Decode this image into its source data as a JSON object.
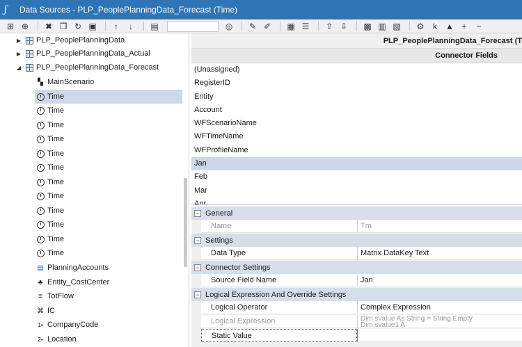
{
  "window": {
    "title": "Data Sources - PLP_PeoplePlanningData_Forecast  (Time)"
  },
  "toolbar": {
    "search_placeholder": ""
  },
  "tree": {
    "items": [
      {
        "label": "PLP_PeoplePlanningData",
        "indent": 0,
        "caret": "▶",
        "icon": "table-grid-icon"
      },
      {
        "label": "PLP_PeoplePlanningData_Actual",
        "indent": 0,
        "caret": "▶",
        "icon": "table-grid-icon"
      },
      {
        "label": "PLP_PeoplePlanningData_Forecast",
        "indent": 0,
        "caret": "◢",
        "icon": "table-grid-icon"
      },
      {
        "label": "MainScenario",
        "indent": 1,
        "caret": "",
        "icon": "scenario-icon"
      },
      {
        "label": "Time",
        "indent": 1,
        "caret": "",
        "icon": "clock-icon",
        "selected": true
      },
      {
        "label": "Time",
        "indent": 1,
        "caret": "",
        "icon": "clock-icon"
      },
      {
        "label": "Time",
        "indent": 1,
        "caret": "",
        "icon": "clock-icon"
      },
      {
        "label": "Time",
        "indent": 1,
        "caret": "",
        "icon": "clock-icon"
      },
      {
        "label": "Time",
        "indent": 1,
        "caret": "",
        "icon": "clock-icon"
      },
      {
        "label": "Time",
        "indent": 1,
        "caret": "",
        "icon": "clock-icon"
      },
      {
        "label": "Time",
        "indent": 1,
        "caret": "",
        "icon": "clock-icon"
      },
      {
        "label": "Time",
        "indent": 1,
        "caret": "",
        "icon": "clock-icon"
      },
      {
        "label": "Time",
        "indent": 1,
        "caret": "",
        "icon": "clock-icon"
      },
      {
        "label": "Time",
        "indent": 1,
        "caret": "",
        "icon": "clock-icon"
      },
      {
        "label": "Time",
        "indent": 1,
        "caret": "",
        "icon": "clock-icon"
      },
      {
        "label": "Time",
        "indent": 1,
        "caret": "",
        "icon": "clock-icon"
      },
      {
        "label": "PlanningAccounts",
        "indent": 1,
        "caret": "",
        "icon": "account-icon"
      },
      {
        "label": "Entity_CostCenter",
        "indent": 1,
        "caret": "",
        "icon": "hierarchy-icon"
      },
      {
        "label": "TotFlow",
        "indent": 1,
        "caret": "",
        "icon": "flow-icon"
      },
      {
        "label": "IC",
        "indent": 1,
        "caret": "",
        "icon": "ic-icon"
      },
      {
        "label": "CompanyCode",
        "indent": 1,
        "caret": "",
        "icon": "ud-icon",
        "badge": "1"
      },
      {
        "label": "Location",
        "indent": 1,
        "caret": "",
        "icon": "ud-icon",
        "badge": "2"
      }
    ]
  },
  "table": {
    "header": "PLP_PeoplePlanningData_Forecast  (T",
    "column": "Connector Fields",
    "fields": [
      "(Unassigned)",
      "RegisterID",
      "Entity",
      "Account",
      "WFScenarioName",
      "WFTimeName",
      "WFProfileName",
      "Jan",
      "Feb",
      "Mar",
      "Apr"
    ],
    "selected_field": "Jan"
  },
  "properties": {
    "sections": [
      {
        "type": "cat",
        "label": "General"
      },
      {
        "type": "prop",
        "name": "Name",
        "value": "Tm",
        "muted": true
      },
      {
        "type": "cat",
        "label": "Settings"
      },
      {
        "type": "prop",
        "name": "Data Type",
        "value": "Matrix DataKey Text"
      },
      {
        "type": "cat",
        "label": "Connector Settings"
      },
      {
        "type": "prop",
        "name": "Source Field Name",
        "value": "Jan"
      },
      {
        "type": "cat",
        "label": "Logical Expression And Override Settings"
      },
      {
        "type": "prop",
        "name": "Logical Operator",
        "value": "Complex Expression"
      },
      {
        "type": "prop",
        "name": "Logical Expression",
        "value": "Dim svalue As String = String.Empty",
        "value2": "Dim svalue1 A",
        "muted": true
      },
      {
        "type": "prop",
        "name": "Static Value",
        "value": ""
      }
    ]
  },
  "colors": {
    "titlebar": "#2f75b5",
    "selection": "#cfd8ea",
    "category": "#d6deea"
  }
}
